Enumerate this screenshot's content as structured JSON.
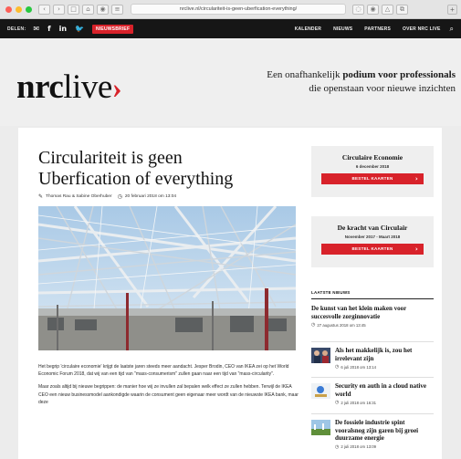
{
  "browser": {
    "url": "nrclive.nl/circulariteit-is-geen-uberfication-everything/",
    "buttons": [
      "‹",
      "›",
      "□",
      "⌂",
      "◉",
      "≡"
    ],
    "right_buttons": [
      "◌",
      "◉",
      "△",
      "⧉"
    ]
  },
  "topnav": {
    "share_label": "DELEN:",
    "newsletter_label": "NIEUWSBRIEF",
    "links": [
      "KALENDER",
      "NIEUWS",
      "PARTNERS",
      "OVER NRC LIVE"
    ]
  },
  "header": {
    "logo_bold": "nrc",
    "logo_light": "live",
    "logo_arrow": "›",
    "tagline_line1_pre": "Een onafhankelijk ",
    "tagline_line1_bold": "podium voor professionals",
    "tagline_line2": "die openstaan voor nieuwe inzichten"
  },
  "article": {
    "title_line1": "Circulariteit is geen",
    "title_line2": "Uberfication of everything",
    "authors": "Thomas Rau & Sabine Oberhuber",
    "date": "20 februari 2018 om 13:04",
    "paragraph1": "Het begrip 'circulaire economie' krijgt de laatste jaren steeds meer aandacht. Jesper Brodin, CEO van IKEA zei op het World Economic Forum 2018, dat wij van een tijd van \"mass-consumerism\" zullen gaan naar een tijd van \"mass-circularity\".",
    "paragraph2": "Maar zoals altijd bij nieuwe begrippen: de manier hoe wij ze invullen zal bepalen welk effect ze zullen hebben. Terwijl de IKEA CEO een nieuw businessmodel aankondigde waarin de consument geen eigenaar meer wordt van de nieuwste IKEA bank, maar deze"
  },
  "sidebar": {
    "promos": [
      {
        "title": "Circulaire Economie",
        "date": "6 december 2018",
        "button": "BESTEL KAARTEN",
        "chevron": "›"
      },
      {
        "title": "De kracht van Circulair",
        "date": "November 2017 - Maart 2018",
        "button": "BESTEL KAARTEN",
        "chevron": "›"
      }
    ],
    "latest_heading": "LAATSTE NIEUWS",
    "news": [
      {
        "title": "De kunst van het klein maken voor succesvolle zorginnovatie",
        "date": "27 augustus 2018 om 13:45"
      },
      {
        "title": "Als het makkelijk is, zou het irrelevant zijn",
        "date": "6 juli 2018 om 13:14"
      },
      {
        "title": "Security en auth in a cloud native world",
        "date": "2 juli 2018 om 16:31"
      },
      {
        "title": "De fossiele industrie spint vooralsnog zijn garen bij groei duurzame energie",
        "date": "2 juli 2018 om 13:09"
      }
    ]
  }
}
